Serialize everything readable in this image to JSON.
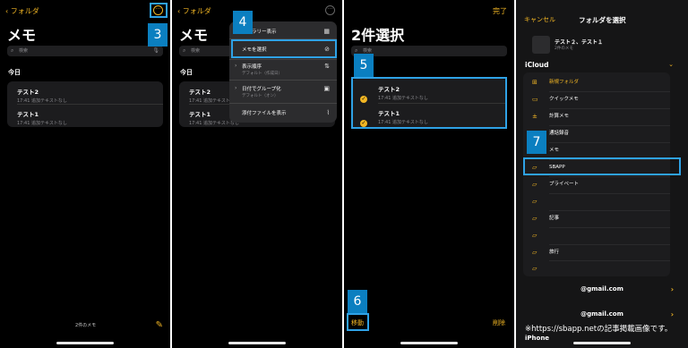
{
  "panel1": {
    "back": "‹ フォルダ",
    "title": "メモ",
    "search": "検索",
    "section": "今日",
    "notes": [
      {
        "title": "テスト2",
        "sub": "17:41  追加テキストなし"
      },
      {
        "title": "テスト1",
        "sub": "17:41  追加テキストなし"
      }
    ],
    "count": "2件のメモ",
    "badge": "3"
  },
  "panel2": {
    "back": "‹ フォルダ",
    "title": "メモ",
    "search": "検索",
    "section": "今日",
    "notes": [
      {
        "title": "テスト2",
        "sub": "17:41  追加テキストなし"
      },
      {
        "title": "テスト1",
        "sub": "17:41  追加テキストなし"
      }
    ],
    "badge": "4",
    "menu": {
      "gallery": "ギャラリー表示",
      "select": "メモを選択",
      "sort": "表示順序",
      "sort_sub": "デフォルト（作成日）",
      "group": "日付でグループ化",
      "group_sub": "デフォルト（オン）",
      "attachments": "添付ファイルを表示"
    }
  },
  "panel3": {
    "done": "完了",
    "title": "2件選択",
    "search": "検索",
    "notes": [
      {
        "title": "テスト2",
        "sub": "17:41  追加テキストなし"
      },
      {
        "title": "テスト1",
        "sub": "17:41  追加テキストなし"
      }
    ],
    "badge5": "5",
    "badge6": "6",
    "move": "移動",
    "delete": "削除"
  },
  "panel4": {
    "cancel": "キャンセル",
    "title": "フォルダを選択",
    "selected": "テスト２、テスト１",
    "selected_sub": "2件のメモ",
    "icloud": "iCloud",
    "badge": "7",
    "folders": [
      {
        "label": "新規フォルダ",
        "highlight": true
      },
      {
        "label": "クイックメモ"
      },
      {
        "label": "計算メモ"
      },
      {
        "label": "通話録音"
      },
      {
        "label": "メモ"
      },
      {
        "label": "SBAPP"
      },
      {
        "label": "プライベート"
      },
      {
        "label": ""
      },
      {
        "label": "記事"
      },
      {
        "label": ""
      },
      {
        "label": "旅行"
      },
      {
        "label": ""
      }
    ],
    "account1": "@gmail.com",
    "account2": "@gmail.com",
    "iphone": "iPhone"
  },
  "watermark": "※https://sbapp.netの記事掲載画像です。"
}
